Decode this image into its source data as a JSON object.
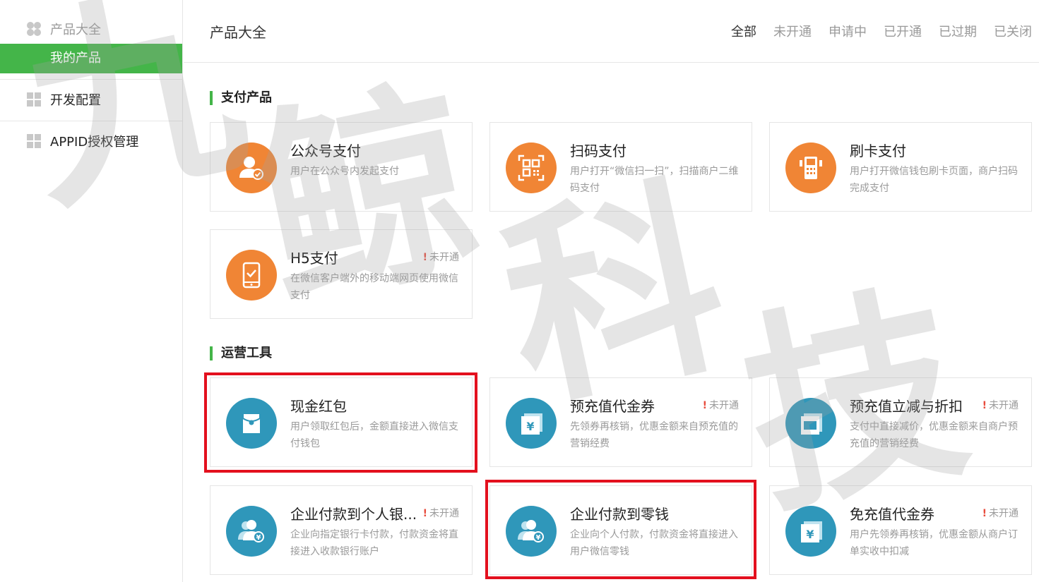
{
  "sidebar": {
    "items": [
      {
        "label": "产品大全"
      },
      {
        "label": "我的产品"
      },
      {
        "label": "开发配置"
      },
      {
        "label": "APPID授权管理"
      }
    ]
  },
  "header": {
    "title": "产品大全",
    "tabs": [
      {
        "label": "全部"
      },
      {
        "label": "未开通"
      },
      {
        "label": "申请中"
      },
      {
        "label": "已开通"
      },
      {
        "label": "已过期"
      },
      {
        "label": "已关闭"
      }
    ]
  },
  "sections": [
    {
      "title": "支付产品"
    },
    {
      "title": "运营工具"
    }
  ],
  "cards": [
    {
      "name": "公众号支付",
      "desc": "用户在公众号内发起支付",
      "status": "",
      "icon": "user-pay-icon"
    },
    {
      "name": "扫码支付",
      "desc": "用户打开“微信扫一扫”，扫描商户二维码支付",
      "status": "",
      "icon": "qr-code-icon"
    },
    {
      "name": "刷卡支付",
      "desc": "用户打开微信钱包刷卡页面，商户扫码完成支付",
      "status": "",
      "icon": "pos-terminal-icon"
    },
    {
      "name": "H5支付",
      "desc": "在微信客户端外的移动端网页使用微信支付",
      "status": "未开通",
      "icon": "mobile-check-icon"
    },
    {
      "name": "现金红包",
      "desc": "用户领取红包后，金额直接进入微信支付钱包",
      "status": "",
      "icon": "red-envelope-icon"
    },
    {
      "name": "预充值代金券",
      "desc": "先领券再核销，优惠金额来自预充值的营销经费",
      "status": "未开通",
      "icon": "coupon-yen-icon"
    },
    {
      "name": "预充值立减与折扣",
      "desc": "支付中直接减价，优惠金额来自商户预充值的营销经费",
      "status": "未开通",
      "icon": "discount-coupon-icon"
    },
    {
      "name": "企业付款到个人银...",
      "desc": "企业向指定银行卡付款，付款资金将直接进入收款银行账户",
      "status": "未开通",
      "icon": "users-yen-icon"
    },
    {
      "name": "企业付款到零钱",
      "desc": "企业向个人付款，付款资金将直接进入用户微信零钱",
      "status": "",
      "icon": "users-yen-icon"
    },
    {
      "name": "免充值代金券",
      "desc": "用户先领券再核销，优惠金额从商户订单实收中扣减",
      "status": "未开通",
      "icon": "coupon-yen-icon"
    }
  ],
  "watermark": {
    "chars": [
      "九",
      "鲸",
      "科",
      "技"
    ]
  },
  "colors": {
    "accent": "#44b549",
    "orange": "#f08535",
    "teal": "#2f97ba",
    "highlight": "#e3101e",
    "warn": "#e84c3d"
  }
}
